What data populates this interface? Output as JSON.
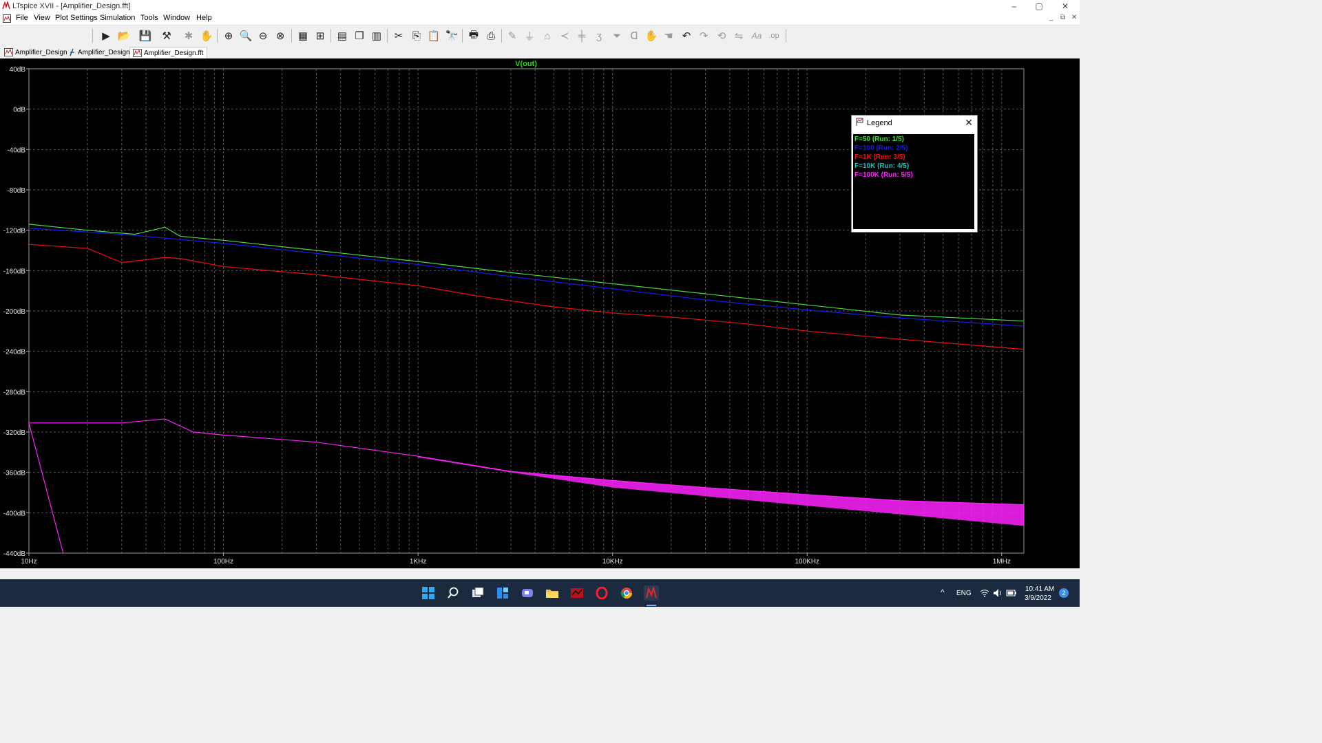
{
  "window": {
    "title": "LTspice XVII - [Amplifier_Design.fft]",
    "controls": {
      "minimize": "–",
      "maximize": "▢",
      "close": "✕"
    },
    "mdi_controls": {
      "minimize": "_",
      "restore": "⧉",
      "close": "✕"
    }
  },
  "menu": [
    "File",
    "View",
    "Plot Settings",
    "Simulation",
    "Tools",
    "Window",
    "Help"
  ],
  "toolbar": [
    {
      "icon": "run-icon"
    },
    {
      "icon": "open-icon"
    },
    {
      "icon": "save-icon"
    },
    {
      "icon": "control-panel-icon"
    },
    {
      "icon": "halt-icon"
    },
    {
      "icon": "pan-hand-icon"
    },
    {
      "icon": "zoom-in-icon"
    },
    {
      "icon": "zoom-area-icon"
    },
    {
      "icon": "zoom-out-icon"
    },
    {
      "icon": "zoom-fit-icon"
    },
    {
      "icon": "autorange-icon"
    },
    {
      "icon": "grid-icon"
    },
    {
      "icon": "tile-horizontal-icon"
    },
    {
      "icon": "cascade-icon"
    },
    {
      "icon": "tile-vertical-icon"
    },
    {
      "icon": "cut-icon"
    },
    {
      "icon": "copy-icon"
    },
    {
      "icon": "paste-icon"
    },
    {
      "icon": "find-icon"
    },
    {
      "icon": "print-icon"
    },
    {
      "icon": "print-preview-icon"
    },
    {
      "icon": "wire-icon"
    },
    {
      "icon": "ground-icon"
    },
    {
      "icon": "label-icon"
    },
    {
      "icon": "resistor-icon"
    },
    {
      "icon": "capacitor-icon"
    },
    {
      "icon": "inductor-icon"
    },
    {
      "icon": "diode-icon"
    },
    {
      "icon": "component-icon"
    },
    {
      "icon": "move-icon"
    },
    {
      "icon": "drag-icon"
    },
    {
      "icon": "undo-icon"
    },
    {
      "icon": "redo-icon"
    },
    {
      "icon": "rotate-icon"
    },
    {
      "icon": "mirror-icon"
    },
    {
      "icon": "text-icon"
    },
    {
      "icon": "spice-directive-icon"
    }
  ],
  "tabs": [
    {
      "label": "Amplifier_Design",
      "icon": "schematic-icon",
      "active": false
    },
    {
      "label": "Amplifier_Design",
      "icon": "waveform-icon",
      "active": false
    },
    {
      "label": "Amplifier_Design.fft",
      "icon": "fft-icon",
      "active": true
    }
  ],
  "legend": {
    "title": "Legend",
    "close": "✕",
    "entries": [
      {
        "label": "F=50  (Run: 1/5)",
        "color": "#44dd44"
      },
      {
        "label": "F=100  (Run: 2/5)",
        "color": "#1a1aee"
      },
      {
        "label": "F=1K  (Run: 3/5)",
        "color": "#ee1111"
      },
      {
        "label": "F=10K  (Run: 4/5)",
        "color": "#22bbbb"
      },
      {
        "label": "F=100K  (Run: 5/5)",
        "color": "#ff22ff"
      }
    ]
  },
  "chart_data": {
    "type": "line",
    "title": "V(out)",
    "x_scale": "log",
    "y_unit": "dB",
    "xlim": [
      10,
      1300000
    ],
    "ylim": [
      -440,
      40
    ],
    "x_ticks": [
      {
        "value": 10,
        "label": "10Hz"
      },
      {
        "value": 100,
        "label": "100Hz"
      },
      {
        "value": 1000,
        "label": "1KHz"
      },
      {
        "value": 10000,
        "label": "10KHz"
      },
      {
        "value": 100000,
        "label": "100KHz"
      },
      {
        "value": 1000000,
        "label": "1MHz"
      }
    ],
    "y_ticks": [
      {
        "value": 40,
        "label": "40dB"
      },
      {
        "value": 0,
        "label": "0dB"
      },
      {
        "value": -40,
        "label": "-40dB"
      },
      {
        "value": -80,
        "label": "-80dB"
      },
      {
        "value": -120,
        "label": "-120dB"
      },
      {
        "value": -160,
        "label": "-160dB"
      },
      {
        "value": -200,
        "label": "-200dB"
      },
      {
        "value": -240,
        "label": "-240dB"
      },
      {
        "value": -280,
        "label": "-280dB"
      },
      {
        "value": -320,
        "label": "-320dB"
      },
      {
        "value": -360,
        "label": "-360dB"
      },
      {
        "value": -400,
        "label": "-400dB"
      },
      {
        "value": -440,
        "label": "-440dB"
      }
    ],
    "grid": true,
    "legend_position": "top-right",
    "series": [
      {
        "name": "F=50  (Run: 1/5)",
        "color": "#44dd44",
        "x": [
          10,
          20,
          35,
          50,
          60,
          100,
          300,
          1000,
          3000,
          10000,
          30000,
          100000,
          300000,
          1300000
        ],
        "y": [
          -114,
          -120,
          -124,
          -117,
          -126,
          -130,
          -140,
          -151,
          -162,
          -173,
          -183,
          -194,
          -204,
          -210
        ]
      },
      {
        "name": "F=100  (Run: 2/5)",
        "color": "#1a1aee",
        "x": [
          10,
          30,
          100,
          300,
          1000,
          3000,
          10000,
          30000,
          100000,
          300000,
          1300000
        ],
        "y": [
          -118,
          -124,
          -133,
          -143,
          -154,
          -166,
          -178,
          -189,
          -199,
          -207,
          -215
        ]
      },
      {
        "name": "F=1K  (Run: 3/5)",
        "color": "#ee1111",
        "x": [
          10,
          20,
          30,
          50,
          60,
          100,
          300,
          1000,
          2000,
          3000,
          5000,
          10000,
          20000,
          50000,
          100000,
          300000,
          1300000
        ],
        "y": [
          -134,
          -138,
          -152,
          -147,
          -148,
          -156,
          -164,
          -175,
          -185,
          -190,
          -196,
          -202,
          -206,
          -213,
          -220,
          -228,
          -238
        ]
      },
      {
        "name": "F=10K  (Run: 4/5)",
        "color": "#22bbbb",
        "x": [],
        "y": []
      },
      {
        "name": "F=100K  (Run: 5/5)",
        "color": "#ff22ff",
        "x": [
          10,
          30,
          50,
          70,
          100,
          300,
          1000,
          3000,
          10000,
          30000,
          100000,
          300000,
          1300000
        ],
        "y": [
          -311,
          -311,
          -307,
          -320,
          -323,
          -330,
          -344,
          -359,
          -368,
          -375,
          -382,
          -388,
          -392
        ],
        "floor_x": [
          1000,
          3000,
          10000,
          100000,
          1300000
        ],
        "floor_y": [
          -345,
          -360,
          -375,
          -393,
          -413
        ],
        "drop_x": [
          10,
          15
        ],
        "drop_y": [
          -311,
          -440
        ]
      }
    ]
  },
  "taskbar": {
    "apps": [
      {
        "icon": "start-icon"
      },
      {
        "icon": "search-icon"
      },
      {
        "icon": "task-view-icon"
      },
      {
        "icon": "widgets-icon"
      },
      {
        "icon": "chat-icon"
      },
      {
        "icon": "file-explorer-icon"
      },
      {
        "icon": "app-red-icon"
      },
      {
        "icon": "opera-icon"
      },
      {
        "icon": "chrome-icon"
      },
      {
        "icon": "ltspice-icon"
      }
    ],
    "tray": {
      "chevron": "^",
      "language": "ENG",
      "time": "10:41 AM",
      "date": "3/9/2022",
      "notifications": "2"
    }
  }
}
